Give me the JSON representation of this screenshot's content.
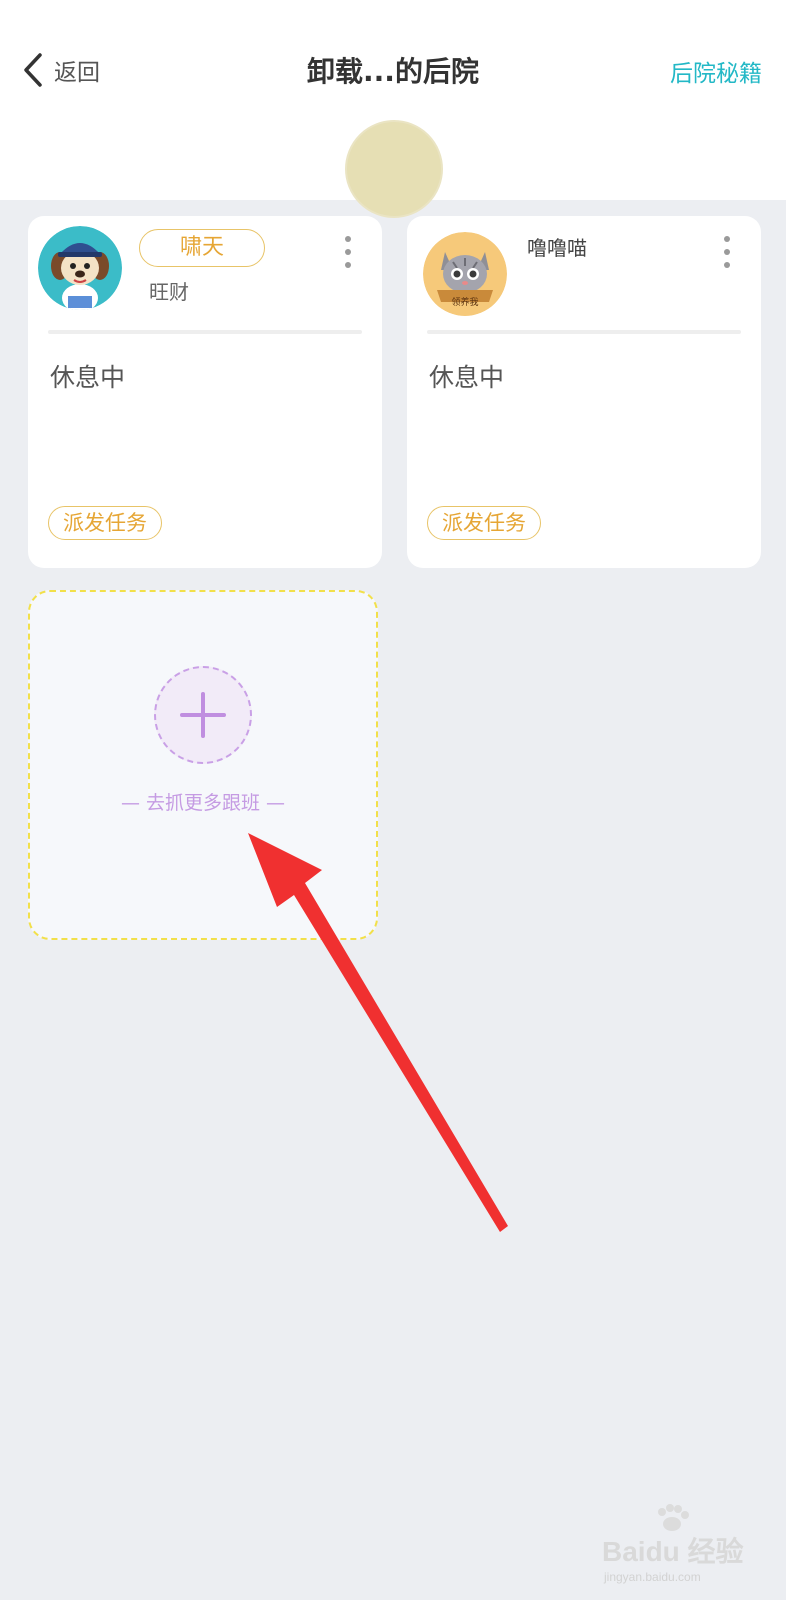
{
  "header": {
    "back_label": "返回",
    "title": "卸载...的后院",
    "right_link": "后院秘籍"
  },
  "cards": [
    {
      "badge": "啸天",
      "name": "旺财",
      "status": "休息中",
      "task_button": "派发任务"
    },
    {
      "name": "噜噜喵",
      "avatar_caption": "领养我",
      "status": "休息中",
      "task_button": "派发任务"
    }
  ],
  "add_card": {
    "label": "— 去抓更多跟班 —"
  },
  "watermark": {
    "brand": "Baidu 经验",
    "url": "jingyan.baidu.com"
  },
  "colors": {
    "accent_teal": "#23b8c6",
    "badge_gold": "#e6a635",
    "add_purple": "#c59be3",
    "dashed_yellow": "#f2e04a",
    "arrow_red": "#f03030"
  }
}
